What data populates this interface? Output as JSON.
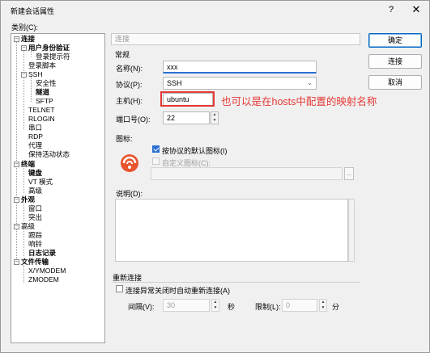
{
  "window": {
    "title": "新建会话属性",
    "help": "?",
    "close": "✕"
  },
  "category_label": "类别(C):",
  "tree": [
    {
      "label": "连接",
      "bold": true
    },
    {
      "label": "用户身份验证",
      "bold": true
    },
    {
      "label": "登录提示符",
      "bold": false
    },
    {
      "label": "登录脚本",
      "bold": false
    },
    {
      "label": "SSH",
      "bold": false
    },
    {
      "label": "安全性",
      "bold": false
    },
    {
      "label": "隧道",
      "bold": true
    },
    {
      "label": "SFTP",
      "bold": false
    },
    {
      "label": "TELNET",
      "bold": false
    },
    {
      "label": "RLOGIN",
      "bold": false
    },
    {
      "label": "串口",
      "bold": false
    },
    {
      "label": "RDP",
      "bold": false
    },
    {
      "label": "代理",
      "bold": false
    },
    {
      "label": "保持活动状态",
      "bold": false
    },
    {
      "label": "终端",
      "bold": true
    },
    {
      "label": "键盘",
      "bold": true
    },
    {
      "label": "VT 模式",
      "bold": false
    },
    {
      "label": "高级",
      "bold": false
    },
    {
      "label": "外观",
      "bold": true
    },
    {
      "label": "窗口",
      "bold": false
    },
    {
      "label": "突出",
      "bold": false
    },
    {
      "label": "高级",
      "bold": false
    },
    {
      "label": "跟踪",
      "bold": false
    },
    {
      "label": "响铃",
      "bold": false
    },
    {
      "label": "日志记录",
      "bold": true
    },
    {
      "label": "文件传输",
      "bold": true
    },
    {
      "label": "X/YMODEM",
      "bold": false
    },
    {
      "label": "ZMODEM",
      "bold": false
    }
  ],
  "header": {
    "label": "连接"
  },
  "general": {
    "group": "常规",
    "name_label": "名称(N):",
    "name_value": "xxx",
    "protocol_label": "协议(P):",
    "protocol_value": "SSH",
    "host_label": "主机(H):",
    "host_value": "ubuntu",
    "port_label": "端口号(O):",
    "port_value": "22"
  },
  "icon_section": {
    "label": "图标:",
    "default_icon_label": "按协议的默认图标(I)",
    "custom_icon_label": "自定义图标(C):",
    "browse": "..."
  },
  "description": {
    "label": "说明(D):"
  },
  "reconnect": {
    "group": "重新连接",
    "checkbox_label": "连接异常关闭时自动重新连接(A)",
    "interval_label": "间隔(V):",
    "interval_value": "30",
    "interval_unit": "秒",
    "limit_label": "限制(L):",
    "limit_value": "0",
    "limit_unit": "分"
  },
  "buttons": {
    "ok": "确定",
    "connect": "连接",
    "cancel": "取消"
  },
  "annotation": {
    "text": "也可以是在hosts中配置的映射名称",
    "color": "#e53935"
  },
  "colors": {
    "accent": "#2b6fd1",
    "icon": "#e8542f"
  }
}
